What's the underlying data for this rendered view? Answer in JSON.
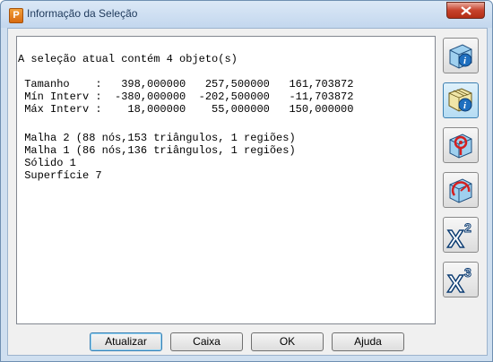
{
  "window": {
    "title": "Informação da Seleção",
    "app_icon_letter": "P"
  },
  "text_pane": {
    "lines": [
      "A seleção atual contém 4 objeto(s)",
      "",
      " Tamanho    :   398,000000   257,500000   161,703872",
      " Mín Interv :  -380,000000  -202,500000   -11,703872",
      " Máx Interv :    18,000000    55,000000   150,000000",
      "",
      " Malha 2 (88 nós,153 triângulos, 1 regiões)",
      " Malha 1 (86 nós,136 triângulos, 1 regiões)",
      " Sólido 1",
      " Superfície 7"
    ]
  },
  "side_toolbar": [
    {
      "icon": "cube-info-icon"
    },
    {
      "icon": "mesh-info-icon"
    },
    {
      "icon": "point-info-icon"
    },
    {
      "icon": "measure-info-icon"
    },
    {
      "icon": "x-squared-icon"
    },
    {
      "icon": "x-cubed-icon"
    }
  ],
  "buttons": {
    "update": "Atualizar",
    "box": "Caixa",
    "ok": "OK",
    "help": "Ajuda"
  },
  "colors": {
    "title_bar": "#c3d7ee",
    "close_button": "#c7422c",
    "icon_blue": "#1f6fbf",
    "icon_red": "#d42020"
  }
}
